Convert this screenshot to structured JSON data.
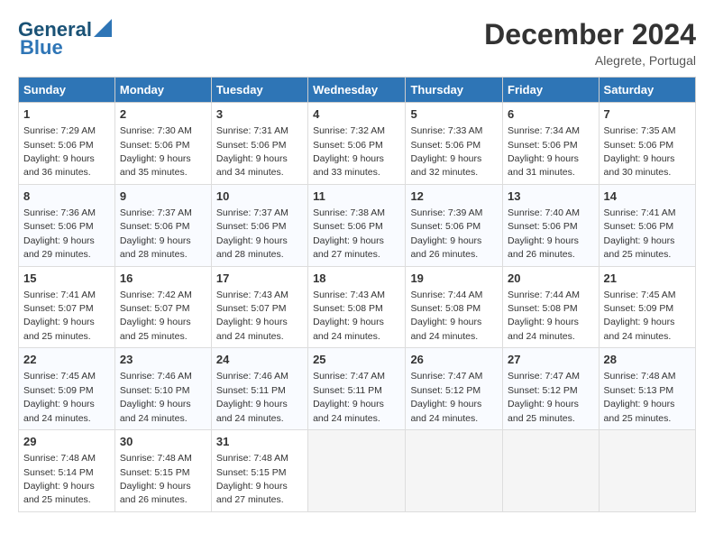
{
  "header": {
    "logo_line1": "General",
    "logo_line2": "Blue",
    "month": "December 2024",
    "location": "Alegrete, Portugal"
  },
  "columns": [
    "Sunday",
    "Monday",
    "Tuesday",
    "Wednesday",
    "Thursday",
    "Friday",
    "Saturday"
  ],
  "weeks": [
    [
      {
        "day": "1",
        "info": "Sunrise: 7:29 AM\nSunset: 5:06 PM\nDaylight: 9 hours\nand 36 minutes."
      },
      {
        "day": "2",
        "info": "Sunrise: 7:30 AM\nSunset: 5:06 PM\nDaylight: 9 hours\nand 35 minutes."
      },
      {
        "day": "3",
        "info": "Sunrise: 7:31 AM\nSunset: 5:06 PM\nDaylight: 9 hours\nand 34 minutes."
      },
      {
        "day": "4",
        "info": "Sunrise: 7:32 AM\nSunset: 5:06 PM\nDaylight: 9 hours\nand 33 minutes."
      },
      {
        "day": "5",
        "info": "Sunrise: 7:33 AM\nSunset: 5:06 PM\nDaylight: 9 hours\nand 32 minutes."
      },
      {
        "day": "6",
        "info": "Sunrise: 7:34 AM\nSunset: 5:06 PM\nDaylight: 9 hours\nand 31 minutes."
      },
      {
        "day": "7",
        "info": "Sunrise: 7:35 AM\nSunset: 5:06 PM\nDaylight: 9 hours\nand 30 minutes."
      }
    ],
    [
      {
        "day": "8",
        "info": "Sunrise: 7:36 AM\nSunset: 5:06 PM\nDaylight: 9 hours\nand 29 minutes."
      },
      {
        "day": "9",
        "info": "Sunrise: 7:37 AM\nSunset: 5:06 PM\nDaylight: 9 hours\nand 28 minutes."
      },
      {
        "day": "10",
        "info": "Sunrise: 7:37 AM\nSunset: 5:06 PM\nDaylight: 9 hours\nand 28 minutes."
      },
      {
        "day": "11",
        "info": "Sunrise: 7:38 AM\nSunset: 5:06 PM\nDaylight: 9 hours\nand 27 minutes."
      },
      {
        "day": "12",
        "info": "Sunrise: 7:39 AM\nSunset: 5:06 PM\nDaylight: 9 hours\nand 26 minutes."
      },
      {
        "day": "13",
        "info": "Sunrise: 7:40 AM\nSunset: 5:06 PM\nDaylight: 9 hours\nand 26 minutes."
      },
      {
        "day": "14",
        "info": "Sunrise: 7:41 AM\nSunset: 5:06 PM\nDaylight: 9 hours\nand 25 minutes."
      }
    ],
    [
      {
        "day": "15",
        "info": "Sunrise: 7:41 AM\nSunset: 5:07 PM\nDaylight: 9 hours\nand 25 minutes."
      },
      {
        "day": "16",
        "info": "Sunrise: 7:42 AM\nSunset: 5:07 PM\nDaylight: 9 hours\nand 25 minutes."
      },
      {
        "day": "17",
        "info": "Sunrise: 7:43 AM\nSunset: 5:07 PM\nDaylight: 9 hours\nand 24 minutes."
      },
      {
        "day": "18",
        "info": "Sunrise: 7:43 AM\nSunset: 5:08 PM\nDaylight: 9 hours\nand 24 minutes."
      },
      {
        "day": "19",
        "info": "Sunrise: 7:44 AM\nSunset: 5:08 PM\nDaylight: 9 hours\nand 24 minutes."
      },
      {
        "day": "20",
        "info": "Sunrise: 7:44 AM\nSunset: 5:08 PM\nDaylight: 9 hours\nand 24 minutes."
      },
      {
        "day": "21",
        "info": "Sunrise: 7:45 AM\nSunset: 5:09 PM\nDaylight: 9 hours\nand 24 minutes."
      }
    ],
    [
      {
        "day": "22",
        "info": "Sunrise: 7:45 AM\nSunset: 5:09 PM\nDaylight: 9 hours\nand 24 minutes."
      },
      {
        "day": "23",
        "info": "Sunrise: 7:46 AM\nSunset: 5:10 PM\nDaylight: 9 hours\nand 24 minutes."
      },
      {
        "day": "24",
        "info": "Sunrise: 7:46 AM\nSunset: 5:11 PM\nDaylight: 9 hours\nand 24 minutes."
      },
      {
        "day": "25",
        "info": "Sunrise: 7:47 AM\nSunset: 5:11 PM\nDaylight: 9 hours\nand 24 minutes."
      },
      {
        "day": "26",
        "info": "Sunrise: 7:47 AM\nSunset: 5:12 PM\nDaylight: 9 hours\nand 24 minutes."
      },
      {
        "day": "27",
        "info": "Sunrise: 7:47 AM\nSunset: 5:12 PM\nDaylight: 9 hours\nand 25 minutes."
      },
      {
        "day": "28",
        "info": "Sunrise: 7:48 AM\nSunset: 5:13 PM\nDaylight: 9 hours\nand 25 minutes."
      }
    ],
    [
      {
        "day": "29",
        "info": "Sunrise: 7:48 AM\nSunset: 5:14 PM\nDaylight: 9 hours\nand 25 minutes."
      },
      {
        "day": "30",
        "info": "Sunrise: 7:48 AM\nSunset: 5:15 PM\nDaylight: 9 hours\nand 26 minutes."
      },
      {
        "day": "31",
        "info": "Sunrise: 7:48 AM\nSunset: 5:15 PM\nDaylight: 9 hours\nand 27 minutes."
      },
      {
        "day": "",
        "info": ""
      },
      {
        "day": "",
        "info": ""
      },
      {
        "day": "",
        "info": ""
      },
      {
        "day": "",
        "info": ""
      }
    ]
  ]
}
